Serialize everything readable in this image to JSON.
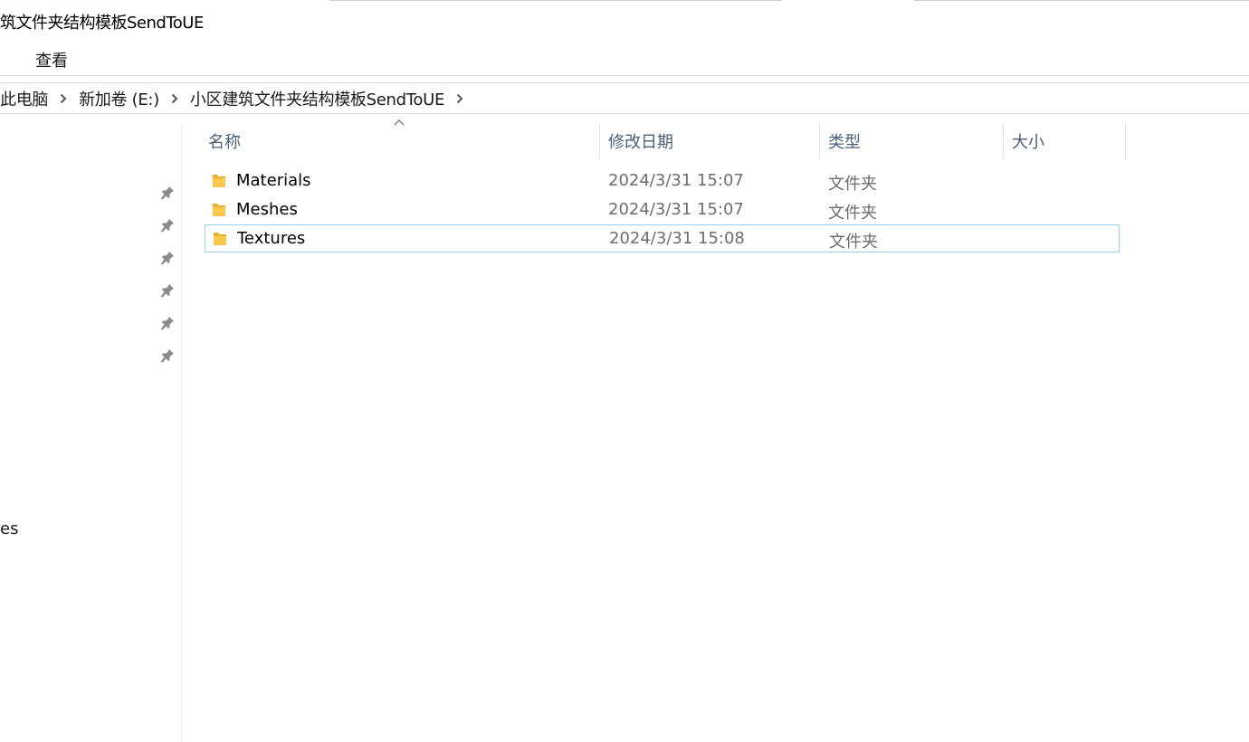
{
  "window": {
    "title": "筑文件夹结构模板SendToUE"
  },
  "menu": {
    "view_label": "查看"
  },
  "breadcrumb": {
    "items": [
      "此电脑",
      "新加卷 (E:)",
      "小区建筑文件夹结构模板SendToUE"
    ]
  },
  "nav": {
    "partial_text": "es"
  },
  "columns": {
    "name": "名称",
    "date": "修改日期",
    "type": "类型",
    "size": "大小"
  },
  "files": [
    {
      "name": "Materials",
      "date": "2024/3/31 15:07",
      "type": "文件夹",
      "size": ""
    },
    {
      "name": "Meshes",
      "date": "2024/3/31 15:07",
      "type": "文件夹",
      "size": ""
    },
    {
      "name": "Textures",
      "date": "2024/3/31 15:08",
      "type": "文件夹",
      "size": ""
    }
  ],
  "colors": {
    "header_text": "#4c607a",
    "selection_border": "#99d1e6",
    "folder_yellow": "#f8c94c",
    "secondary_text": "#6d6d6d"
  },
  "icons": {
    "pin": "pin-icon",
    "folder": "folder-icon",
    "chevron": "chevron-right-icon",
    "sort": "sort-ascending-icon"
  }
}
